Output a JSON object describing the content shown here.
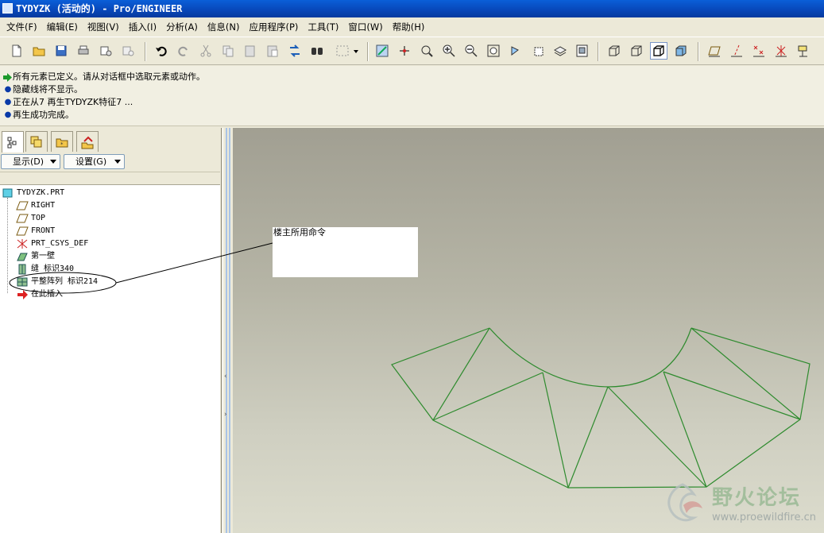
{
  "window": {
    "title": "TYDYZK (活动的) - Pro/ENGINEER"
  },
  "menu": {
    "items": [
      "文件(F)",
      "编辑(E)",
      "视图(V)",
      "插入(I)",
      "分析(A)",
      "信息(N)",
      "应用程序(P)",
      "工具(T)",
      "窗口(W)",
      "帮助(H)"
    ]
  },
  "messages": [
    {
      "kind": "arrow",
      "text": "所有元素已定义。请从对话框中选取元素或动作。"
    },
    {
      "kind": "bullet",
      "text": "隐藏线将不显示。"
    },
    {
      "kind": "bullet",
      "text": "正在从7 再生TYDYZK特征7 ..."
    },
    {
      "kind": "bullet",
      "text": "再生成功完成。"
    }
  ],
  "panel": {
    "show_label": "显示(D)",
    "settings_label": "设置(G)"
  },
  "tree": {
    "root": "TYDYZK.PRT",
    "items": [
      {
        "label": "RIGHT",
        "icon": "datum-plane-icon"
      },
      {
        "label": "TOP",
        "icon": "datum-plane-icon"
      },
      {
        "label": "FRONT",
        "icon": "datum-plane-icon"
      },
      {
        "label": "PRT_CSYS_DEF",
        "icon": "csys-icon"
      },
      {
        "label": "第一壁",
        "icon": "sheetmetal-wall-icon"
      },
      {
        "label": "缝 标识340",
        "icon": "rip-icon"
      },
      {
        "label": "平整阵列 标识214",
        "icon": "flat-pattern-icon"
      },
      {
        "label": "在此插入",
        "icon": "insert-here-icon"
      }
    ]
  },
  "callout": {
    "text": "楼主所用命令"
  },
  "watermark": {
    "title": "野火论坛",
    "url": "www.proewildfire.cn"
  },
  "colors": {
    "edge": "#2e8b2e",
    "titlebar": "#0a5fd8"
  }
}
